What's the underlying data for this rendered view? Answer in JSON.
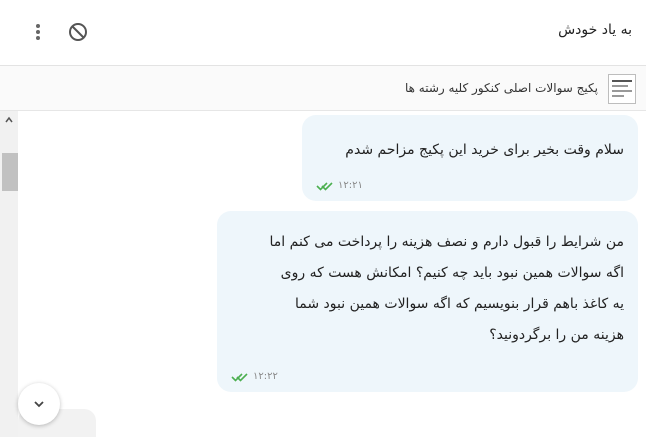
{
  "header": {
    "title": "به یاد خودش",
    "menu_icon": "more-vertical-icon",
    "block_icon": "block-icon"
  },
  "product": {
    "title": "پکیج سوالات اصلی کنکور کلیه رشته ها",
    "thumb_icon": "product-thumbnail"
  },
  "messages": [
    {
      "text": "سلام وقت بخیر برای خرید این پکیج مزاحم شدم",
      "time": "۱۲:۲۱",
      "status_icon": "double-check-icon"
    },
    {
      "lines": [
        "من شرایط را قبول دارم و نصف هزینه را پرداخت می کنم اما",
        "اگه سوالات همین نبود باید چه کنیم؟ امکانش هست که روی",
        "یه کاغذ باهم قرار بنویسیم که اگه سوالات همین نبود شما",
        "هزینه من را برگردونید؟"
      ],
      "time": "۱۲:۲۲",
      "status_icon": "double-check-icon"
    }
  ],
  "colors": {
    "bubble_bg": "#eef6fb",
    "check": "#4caf50"
  }
}
